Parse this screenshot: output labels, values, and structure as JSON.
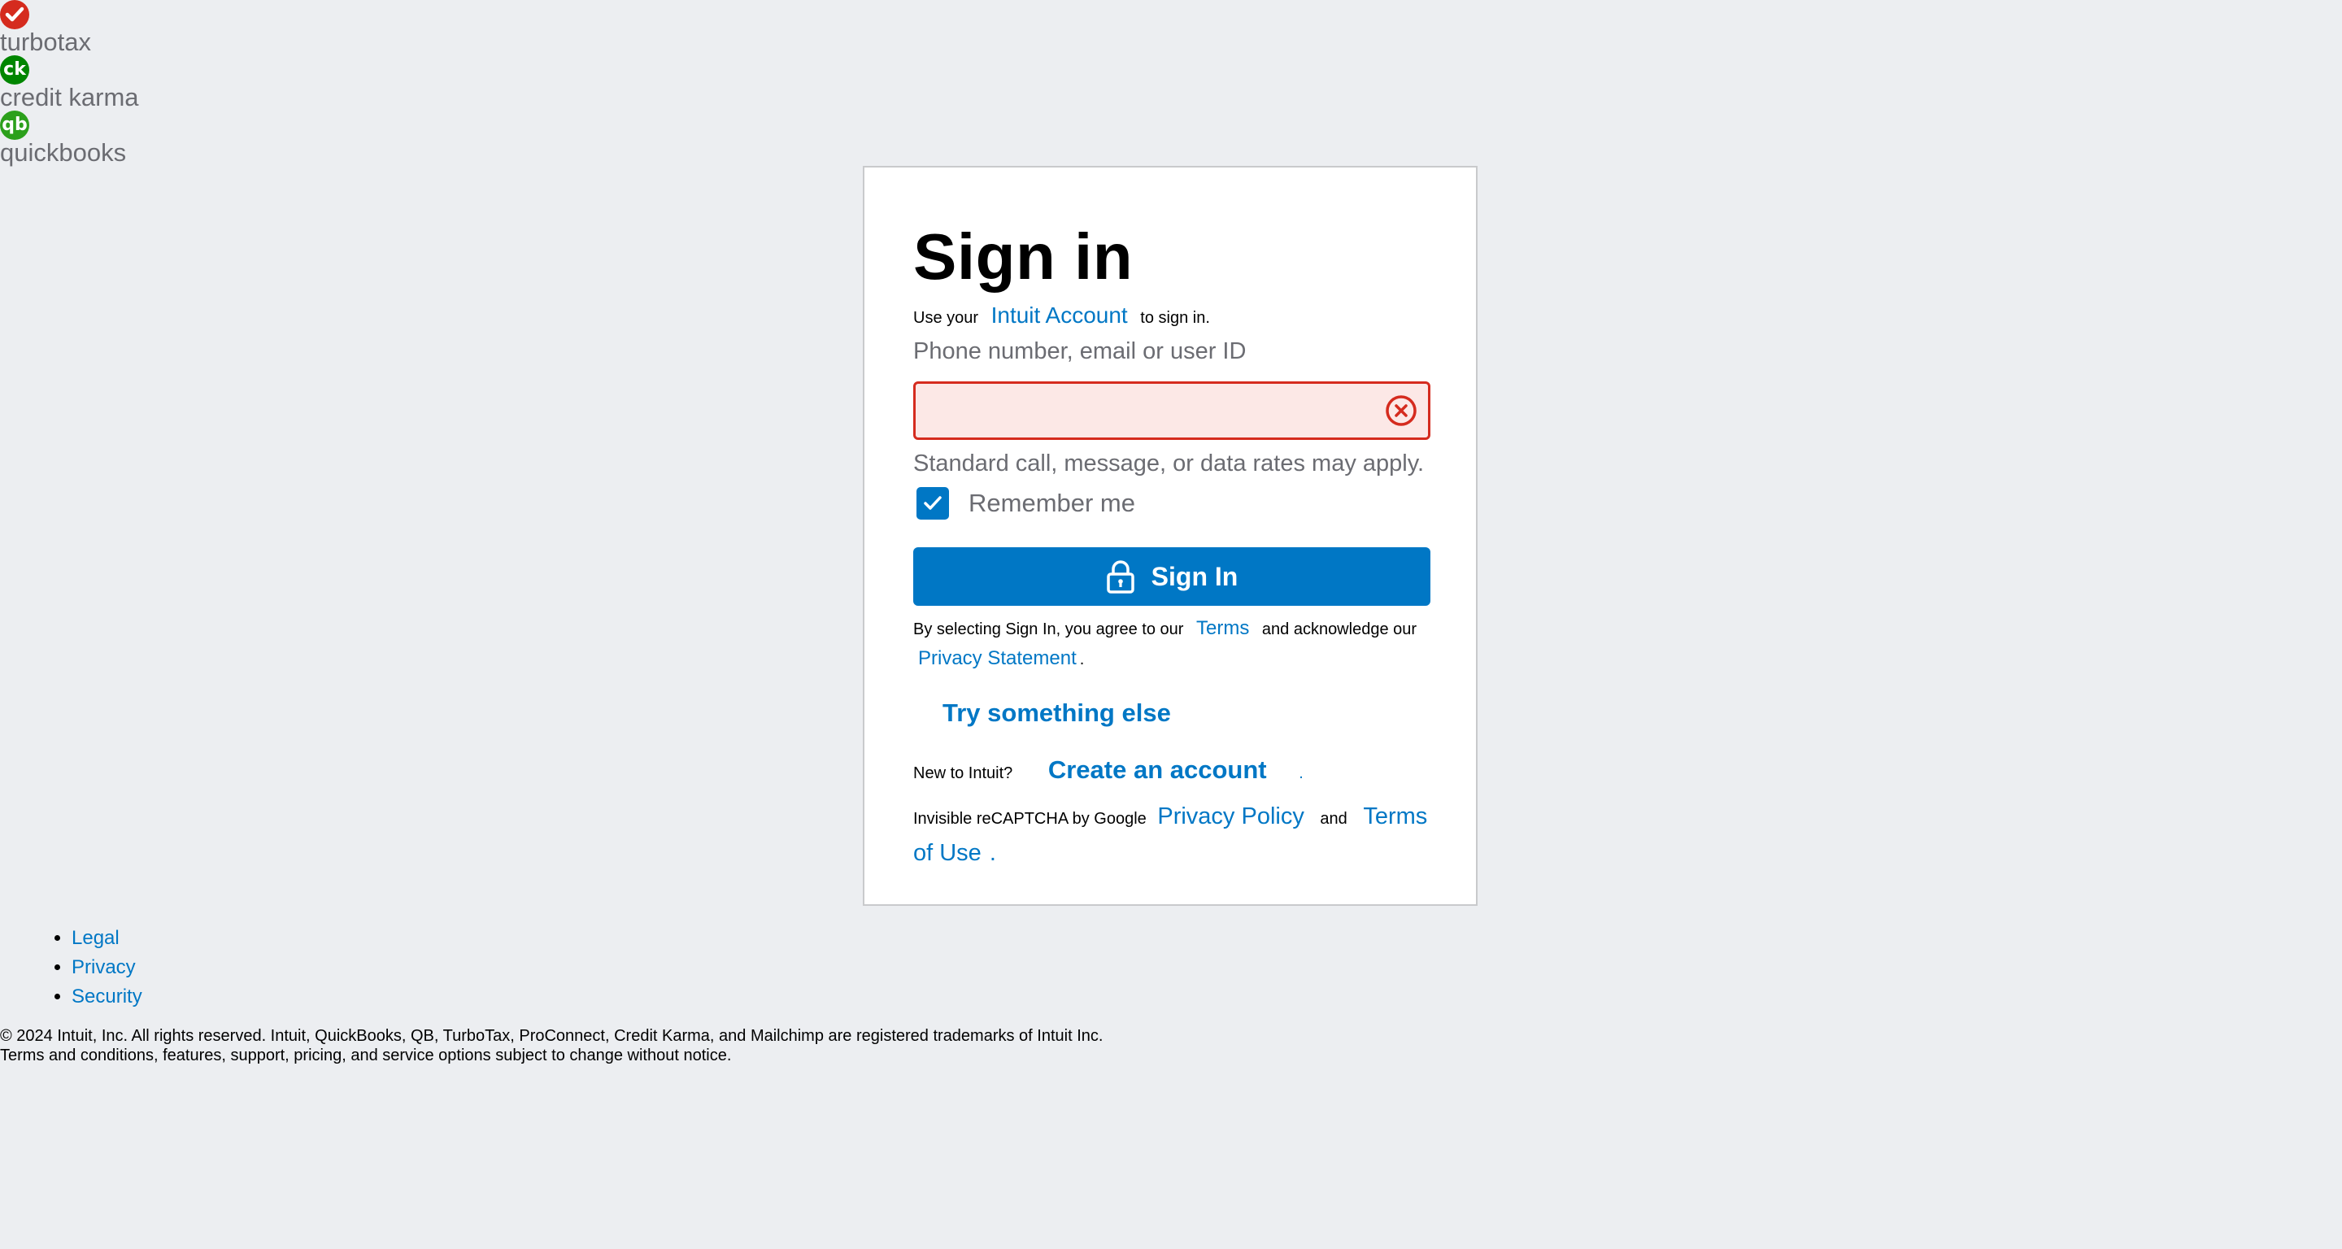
{
  "brands": [
    {
      "name": "turbotax",
      "logo_text": "✓",
      "color": "#d52b1e"
    },
    {
      "name": "credit karma",
      "logo_text": "ck",
      "color": "#008600"
    },
    {
      "name": "quickbooks",
      "logo_text": "qb",
      "color": "#2ca01c"
    }
  ],
  "signin": {
    "title": "Sign in",
    "subtitle_prefix": "Use your",
    "subtitle_link": "Intuit Account",
    "subtitle_suffix": "to sign in.",
    "field_label": "Phone number, email or user ID",
    "field_value": "",
    "hint": "Standard call, message, or data rates may apply.",
    "remember_label": "Remember me",
    "remember_checked": true,
    "button_label": "Sign In",
    "agree_prefix": "By selecting Sign In, you agree to our",
    "terms_link": "Terms",
    "agree_middle": "and acknowledge our",
    "privacy_link": "Privacy Statement",
    "agree_suffix": ".",
    "try_else": "Try something else",
    "new_prefix": "New to Intuit?",
    "create_link": "Create an account",
    "create_suffix": ".",
    "recaptcha_prefix": "Invisible reCAPTCHA by Google",
    "recaptcha_privacy": "Privacy Policy",
    "recaptcha_and": "and",
    "recaptcha_terms": "Terms of Use",
    "recaptcha_suffix": "."
  },
  "footer": {
    "links": [
      "Legal",
      "Privacy",
      "Security"
    ],
    "copyright_line1": "© 2024 Intuit, Inc. All rights reserved. Intuit, QuickBooks, QB, TurboTax, ProConnect, Credit Karma, and Mailchimp are registered trademarks of Intuit Inc.",
    "copyright_line2": "Terms and conditions, features, support, pricing, and service options subject to change without notice."
  },
  "colors": {
    "accent": "#0077c5",
    "error": "#d52b1e",
    "error_bg": "#fce8e6",
    "page_bg": "#eceef1"
  }
}
